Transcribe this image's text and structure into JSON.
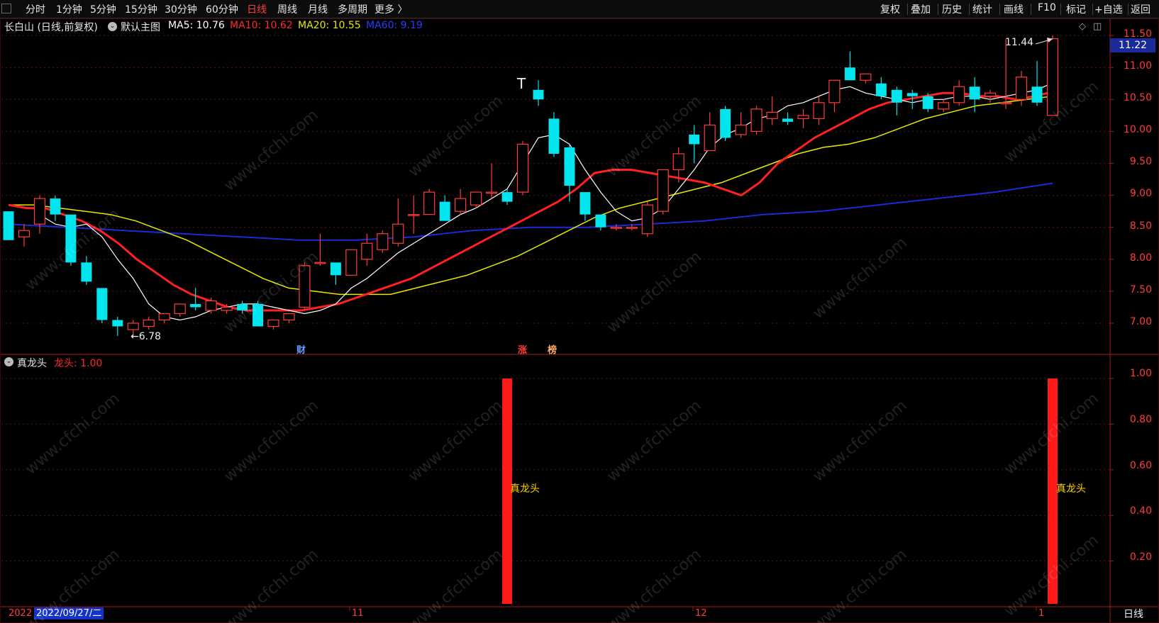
{
  "toolbar": {
    "left_items": [
      "分时",
      "1分钟",
      "5分钟",
      "15分钟",
      "30分钟",
      "60分钟",
      "日线",
      "周线",
      "月线",
      "多周期",
      "更多 〉"
    ],
    "active": "日线",
    "right_items": [
      "复权",
      "叠加",
      "历史",
      "统计",
      "画线",
      "F10",
      "标记",
      "+自选",
      "返回"
    ]
  },
  "main_info": {
    "title": "长白山 (日线,前复权)",
    "template": "默认主图",
    "ma5": "MA5: 10.76",
    "ma10": "MA10: 10.62",
    "ma20": "MA20: 10.55",
    "ma60": "MA60: 9.19"
  },
  "colors": {
    "up": "#ff3b3b",
    "down": "#00e5ee",
    "ma5": "#ffffff",
    "ma10": "#ff2020",
    "ma20": "#e8e800",
    "ma60": "#1a2bd6",
    "axis": "#ff3b3b",
    "signal": "#ff1a1a"
  },
  "price_axis": [
    "11.50",
    "11.00",
    "10.50",
    "10.00",
    "9.50",
    "9.00",
    "8.50",
    "8.00",
    "7.50",
    "7.00"
  ],
  "current_price": "11.22",
  "annotations": {
    "high": "11.44",
    "low": "←6.78",
    "t_marker": "T"
  },
  "markers": [
    "财",
    "涨",
    "榜"
  ],
  "indicator": {
    "name": "真龙头",
    "value_label": "龙头: 1.00",
    "axis": [
      "1.00",
      "0.80",
      "0.60",
      "0.40",
      "0.20"
    ],
    "signal_label": "真龙头"
  },
  "date_axis": {
    "year": "2022",
    "selected": "2022/09/27/二",
    "months": [
      "11",
      "12",
      "1"
    ]
  },
  "footer_tab": "日线",
  "watermark": "www.cfchi.com",
  "chart_data": {
    "type": "candlestick",
    "candles_ohlc": [
      [
        8.75,
        8.75,
        8.3,
        8.3
      ],
      [
        8.35,
        8.55,
        8.2,
        8.45
      ],
      [
        8.55,
        9.0,
        8.4,
        8.95
      ],
      [
        8.95,
        9.0,
        8.6,
        8.7
      ],
      [
        8.7,
        8.7,
        7.9,
        7.95
      ],
      [
        7.95,
        8.05,
        7.6,
        7.65
      ],
      [
        7.55,
        7.55,
        7.0,
        7.05
      ],
      [
        7.05,
        7.1,
        6.8,
        6.95
      ],
      [
        6.9,
        7.05,
        6.78,
        7.0
      ],
      [
        6.95,
        7.1,
        6.9,
        7.05
      ],
      [
        7.05,
        7.15,
        7.0,
        7.15
      ],
      [
        7.15,
        7.3,
        7.1,
        7.3
      ],
      [
        7.3,
        7.55,
        7.2,
        7.25
      ],
      [
        7.2,
        7.4,
        7.15,
        7.35
      ],
      [
        7.2,
        7.3,
        7.15,
        7.25
      ],
      [
        7.3,
        7.35,
        7.15,
        7.2
      ],
      [
        7.3,
        7.35,
        6.95,
        6.95
      ],
      [
        6.95,
        7.05,
        6.9,
        7.05
      ],
      [
        7.05,
        7.15,
        7.0,
        7.15
      ],
      [
        7.25,
        7.95,
        7.2,
        7.9
      ],
      [
        7.95,
        8.4,
        7.9,
        7.95
      ],
      [
        7.95,
        7.75,
        7.6,
        7.75
      ],
      [
        7.75,
        8.15,
        7.75,
        8.15
      ],
      [
        8.0,
        8.4,
        7.9,
        8.25
      ],
      [
        8.15,
        8.45,
        8.1,
        8.4
      ],
      [
        8.25,
        8.95,
        8.2,
        8.55
      ],
      [
        8.7,
        9.0,
        8.4,
        8.7
      ],
      [
        8.7,
        9.1,
        8.7,
        9.05
      ],
      [
        8.9,
        9.0,
        8.6,
        8.6
      ],
      [
        8.75,
        9.1,
        8.7,
        8.95
      ],
      [
        8.85,
        9.05,
        8.8,
        9.05
      ],
      [
        9.05,
        9.5,
        8.95,
        9.05
      ],
      [
        9.05,
        9.1,
        8.85,
        8.9
      ],
      [
        9.05,
        9.85,
        9.0,
        9.8
      ],
      [
        10.65,
        10.8,
        10.4,
        10.5
      ],
      [
        10.2,
        10.3,
        9.6,
        9.65
      ],
      [
        9.75,
        9.8,
        8.9,
        9.15
      ],
      [
        9.05,
        9.05,
        8.6,
        8.7
      ],
      [
        8.7,
        8.7,
        8.45,
        8.5
      ],
      [
        8.5,
        8.55,
        8.45,
        8.5
      ],
      [
        8.5,
        8.55,
        8.45,
        8.5
      ],
      [
        8.4,
        8.9,
        8.35,
        8.85
      ],
      [
        8.75,
        9.25,
        8.7,
        9.4
      ],
      [
        9.4,
        9.75,
        9.2,
        9.65
      ],
      [
        9.95,
        10.1,
        9.5,
        9.8
      ],
      [
        9.7,
        10.3,
        9.7,
        10.1
      ],
      [
        10.35,
        10.4,
        9.85,
        9.9
      ],
      [
        9.95,
        10.3,
        9.9,
        10.1
      ],
      [
        10.0,
        10.4,
        9.95,
        10.35
      ],
      [
        10.2,
        10.55,
        10.1,
        10.3
      ],
      [
        10.2,
        10.3,
        10.1,
        10.15
      ],
      [
        10.2,
        10.35,
        10.05,
        10.25
      ],
      [
        10.2,
        10.55,
        10.1,
        10.45
      ],
      [
        10.45,
        10.75,
        10.3,
        10.8
      ],
      [
        11.0,
        11.25,
        10.8,
        10.8
      ],
      [
        10.8,
        10.9,
        10.75,
        10.9
      ],
      [
        10.75,
        10.85,
        10.5,
        10.55
      ],
      [
        10.65,
        10.7,
        10.25,
        10.45
      ],
      [
        10.6,
        10.65,
        10.35,
        10.55
      ],
      [
        10.55,
        10.6,
        10.3,
        10.35
      ],
      [
        10.35,
        10.5,
        10.3,
        10.45
      ],
      [
        10.45,
        10.8,
        10.4,
        10.7
      ],
      [
        10.7,
        10.85,
        10.3,
        10.5
      ],
      [
        10.55,
        10.65,
        10.45,
        10.6
      ],
      [
        10.45,
        11.44,
        10.35,
        10.45
      ],
      [
        10.5,
        10.95,
        10.4,
        10.85
      ],
      [
        10.7,
        11.1,
        10.4,
        10.45
      ],
      [
        10.25,
        11.5,
        10.25,
        11.45
      ]
    ],
    "ma5": [
      8.7,
      8.55,
      8.5,
      8.55,
      8.35,
      8.0,
      7.7,
      7.3,
      7.1,
      7.05,
      7.1,
      7.2,
      7.25,
      7.3,
      7.3,
      7.25,
      7.2,
      7.15,
      7.2,
      7.3,
      7.55,
      7.7,
      7.9,
      8.1,
      8.25,
      8.4,
      8.55,
      8.7,
      8.8,
      8.95,
      9.1,
      9.5,
      9.9,
      9.95,
      9.8,
      9.4,
      9.05,
      8.75,
      8.6,
      8.65,
      8.8,
      9.1,
      9.4,
      9.75,
      9.95,
      10.05,
      10.2,
      10.25,
      10.4,
      10.45,
      10.55,
      10.65,
      10.7,
      10.6,
      10.55,
      10.5,
      10.45,
      10.5,
      10.5,
      10.55,
      10.55,
      10.5,
      10.55,
      10.6,
      10.65,
      10.76
    ],
    "ma10": [
      8.85,
      8.8,
      8.8,
      8.7,
      8.6,
      8.45,
      8.25,
      8.0,
      7.8,
      7.6,
      7.45,
      7.35,
      7.25,
      7.2,
      7.2,
      7.2,
      7.2,
      7.25,
      7.3,
      7.4,
      7.5,
      7.6,
      7.7,
      7.85,
      8.0,
      8.15,
      8.3,
      8.45,
      8.6,
      8.75,
      8.9,
      9.1,
      9.35,
      9.4,
      9.4,
      9.35,
      9.3,
      9.25,
      9.2,
      9.1,
      9.0,
      9.2,
      9.5,
      9.7,
      9.9,
      10.05,
      10.2,
      10.35,
      10.45,
      10.5,
      10.55,
      10.6,
      10.6,
      10.55,
      10.55,
      10.5,
      10.55,
      10.62
    ],
    "ma20": [
      8.85,
      8.85,
      8.8,
      8.75,
      8.7,
      8.6,
      8.45,
      8.3,
      8.1,
      7.9,
      7.7,
      7.55,
      7.5,
      7.45,
      7.45,
      7.45,
      7.55,
      7.65,
      7.75,
      7.9,
      8.05,
      8.25,
      8.45,
      8.65,
      8.8,
      8.9,
      9.0,
      9.1,
      9.2,
      9.35,
      9.5,
      9.65,
      9.75,
      9.8,
      9.9,
      10.05,
      10.2,
      10.3,
      10.4,
      10.45,
      10.5,
      10.55
    ],
    "ma60": [
      8.55,
      8.5,
      8.45,
      8.4,
      8.35,
      8.3,
      8.3,
      8.35,
      8.45,
      8.5,
      8.5,
      8.55,
      8.6,
      8.7,
      8.75,
      8.85,
      8.95,
      9.05,
      9.19
    ],
    "indicator_signals": [
      {
        "candle_index": 32,
        "value": 1.0
      },
      {
        "candle_index": 67,
        "value": 1.0
      }
    ],
    "ylim": [
      6.7,
      11.55
    ]
  }
}
